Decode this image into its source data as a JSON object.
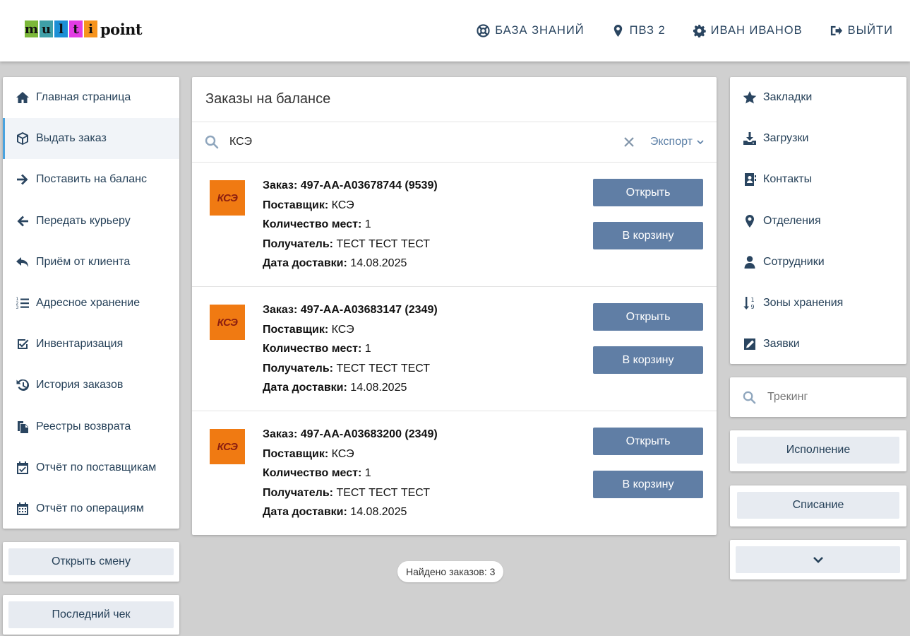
{
  "header": {
    "logo": {
      "letters": [
        "m",
        "u",
        "l",
        "t",
        "i"
      ],
      "colors": [
        "#7cb83a",
        "#3f9fa7",
        "#1d8fd6",
        "#e23ce3",
        "#f7941d"
      ],
      "word": "point"
    },
    "nav": [
      {
        "label": "БАЗА ЗНАНИЙ",
        "icon": "lifebuoy-icon"
      },
      {
        "label": "ПВЗ 2",
        "icon": "map-marker-icon"
      },
      {
        "label": "ИВАН ИВАНОВ",
        "icon": "gear-icon"
      },
      {
        "label": "ВЫЙТИ",
        "icon": "sign-out-icon"
      }
    ]
  },
  "sidebar": {
    "items": [
      {
        "label": "Главная страница",
        "icon": "home-icon"
      },
      {
        "label": "Выдать заказ",
        "icon": "cube-icon",
        "active": true
      },
      {
        "label": "Поставить на баланс",
        "icon": "arrow-right-icon"
      },
      {
        "label": "Передать курьеру",
        "icon": "arrow-left-icon"
      },
      {
        "label": "Приём от клиента",
        "icon": "reply-icon"
      },
      {
        "label": "Адресное хранение",
        "icon": "list-ordered-icon"
      },
      {
        "label": "Инвентаризация",
        "icon": "check-square-icon"
      },
      {
        "label": "История заказов",
        "icon": "history-icon"
      },
      {
        "label": "Реестры возврата",
        "icon": "files-icon"
      },
      {
        "label": "Отчёт по поставщикам",
        "icon": "calendar-check-icon"
      },
      {
        "label": "Отчёт по операциям",
        "icon": "calendar-icon"
      }
    ],
    "open_shift": "Открыть смену",
    "last_receipt": "Последний чек"
  },
  "main": {
    "title": "Заказы на балансе",
    "search_value": "КСЭ",
    "export_label": "Экспорт",
    "labels": {
      "order": "Заказ:",
      "supplier": "Поставщик:",
      "places": "Количество мест:",
      "recipient": "Получатель:",
      "delivery_date": "Дата доставки:"
    },
    "open_label": "Открыть",
    "cart_label": "В корзину",
    "orders": [
      {
        "carrier_logo": "КСЭ",
        "number": "497-АА-А03678744 (9539)",
        "supplier": "КСЭ",
        "places": "1",
        "recipient": "ТЕСТ ТЕСТ ТЕСТ",
        "delivery_date": "14.08.2025"
      },
      {
        "carrier_logo": "КСЭ",
        "number": "497-АА-А03683147 (2349)",
        "supplier": "КСЭ",
        "places": "1",
        "recipient": "ТЕСТ ТЕСТ ТЕСТ",
        "delivery_date": "14.08.2025"
      },
      {
        "carrier_logo": "КСЭ",
        "number": "497-АА-А03683200 (2349)",
        "supplier": "КСЭ",
        "places": "1",
        "recipient": "ТЕСТ ТЕСТ ТЕСТ",
        "delivery_date": "14.08.2025"
      }
    ],
    "found_text": "Найдено заказов: 3"
  },
  "right": {
    "items": [
      {
        "label": "Закладки",
        "icon": "star-icon"
      },
      {
        "label": "Загрузки",
        "icon": "download-icon"
      },
      {
        "label": "Контакты",
        "icon": "address-book-icon"
      },
      {
        "label": "Отделения",
        "icon": "map-marker-icon"
      },
      {
        "label": "Сотрудники",
        "icon": "user-icon"
      },
      {
        "label": "Зоны хранения",
        "icon": "sort-numeric-icon"
      },
      {
        "label": "Заявки",
        "icon": "edit-icon"
      }
    ],
    "tracking_placeholder": "Трекинг",
    "execution": "Исполнение",
    "writeoff": "Списание"
  }
}
